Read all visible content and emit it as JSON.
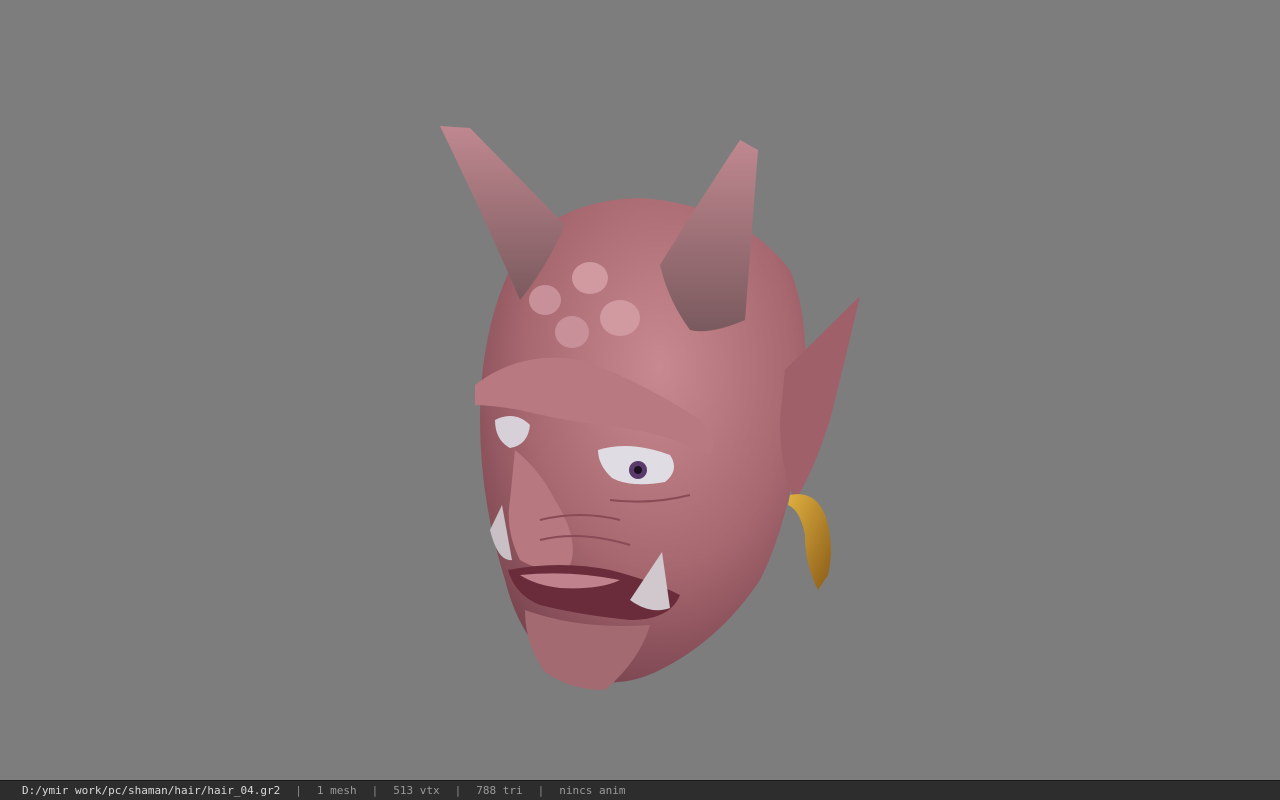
{
  "viewport": {
    "background": "#7d7d7d",
    "model": "oni-demon-head"
  },
  "status_bar": {
    "file_path": "D:/ymir work/pc/shaman/hair/hair_04.gr2",
    "separator": "|",
    "mesh_count": "1 mesh",
    "vertex_count": "513 vtx",
    "triangle_count": "788 tri",
    "anim_status": "nincs anim"
  }
}
